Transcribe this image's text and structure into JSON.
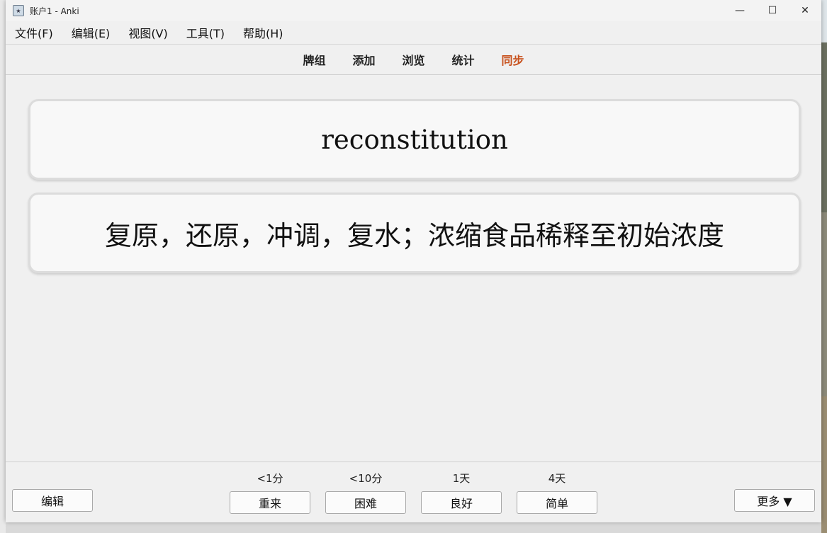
{
  "window": {
    "title": "账户1 - Anki",
    "icon": "anki-icon"
  },
  "window_controls": {
    "minimize": "—",
    "maximize": "☐",
    "close": "✕"
  },
  "menu": [
    {
      "label": "文件(F)"
    },
    {
      "label": "编辑(E)"
    },
    {
      "label": "视图(V)"
    },
    {
      "label": "工具(T)"
    },
    {
      "label": "帮助(H)"
    }
  ],
  "toolbar": {
    "decks": "牌组",
    "add": "添加",
    "browse": "浏览",
    "stats": "统计",
    "sync": "同步",
    "sync_color": "#c8521e"
  },
  "card": {
    "front": "reconstitution",
    "back": "复原，还原，冲调，复水；浓缩食品稀释至初始浓度"
  },
  "bottom": {
    "edit_label": "编辑",
    "more_label": "更多 ▼",
    "answers": [
      {
        "interval": "<1分",
        "label": "重来"
      },
      {
        "interval": "<10分",
        "label": "困难"
      },
      {
        "interval": "1天",
        "label": "良好"
      },
      {
        "interval": "4天",
        "label": "简单"
      }
    ]
  }
}
